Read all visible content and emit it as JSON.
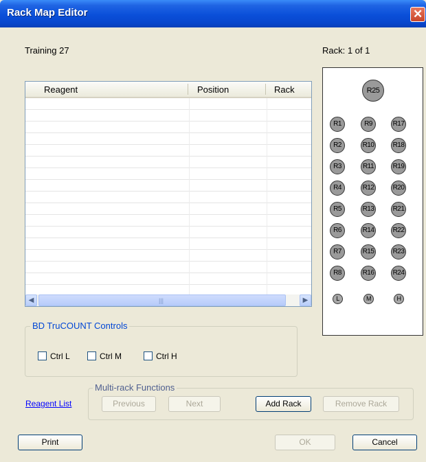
{
  "window": {
    "title": "Rack Map Editor",
    "close_glyph": "✕"
  },
  "panel": {
    "name": "Training 27",
    "rack_indicator": "Rack:  1 of 1"
  },
  "table": {
    "columns": [
      "Reagent",
      "Position",
      "Rack"
    ],
    "rows": [],
    "hscroll_left": "◀",
    "hscroll_right": "▶",
    "hscroll_grip": "|||"
  },
  "rack": {
    "top": "R25",
    "columns": [
      [
        "R1",
        "R2",
        "R3",
        "R4",
        "R5",
        "R6",
        "R7",
        "R8"
      ],
      [
        "R9",
        "R10",
        "R11",
        "R12",
        "R13",
        "R14",
        "R15",
        "R16"
      ],
      [
        "R17",
        "R18",
        "R19",
        "R20",
        "R21",
        "R22",
        "R23",
        "R24"
      ]
    ],
    "bottom": [
      "L",
      "M",
      "H"
    ]
  },
  "trucount": {
    "legend": "BD TruCOUNT Controls",
    "controls": [
      {
        "label": "Ctrl L",
        "checked": false
      },
      {
        "label": "Ctrl M",
        "checked": false
      },
      {
        "label": "Ctrl H",
        "checked": false
      }
    ]
  },
  "multirack": {
    "legend": "Multi-rack Functions",
    "previous": "Previous",
    "next": "Next",
    "add_rack": "Add Rack",
    "remove_rack": "Remove Rack"
  },
  "reagent_list_link": "Reagent List",
  "footer": {
    "print": "Print",
    "ok": "OK",
    "cancel": "Cancel"
  },
  "colors": {
    "title_bar": "#0a4fd9",
    "dialog_bg": "#ece9d8",
    "rack_position": "#9a9a9a",
    "link": "#0000ff"
  }
}
